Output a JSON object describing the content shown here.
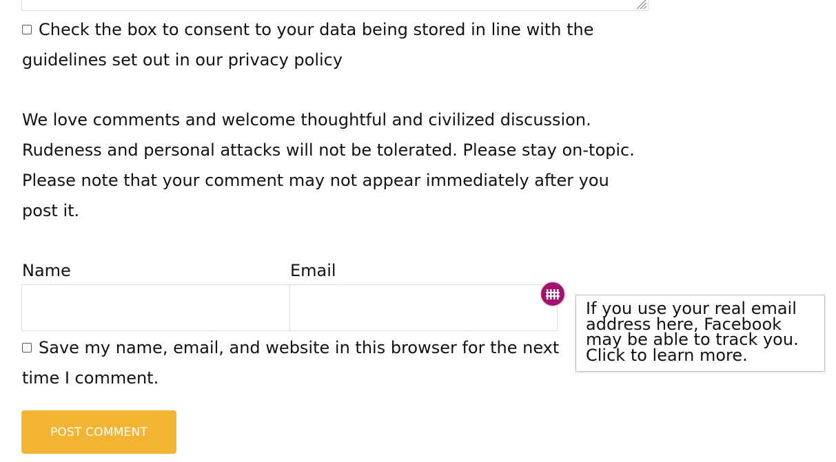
{
  "consent": {
    "text": "Check the box to consent to your data being stored in line with the guidelines set out in our privacy policy"
  },
  "rules": {
    "text": "We love comments and welcome thoughtful and civilized discussion. Rudeness and personal attacks will not be tolerated. Please stay on-topic. Please note that your comment may not appear immediately after you post it."
  },
  "form": {
    "name_label": "Name",
    "email_label": "Email",
    "name_value": "",
    "email_value": "",
    "save_info_text": "Save my name, email, and website in this browser for the next time I comment."
  },
  "submit": {
    "label": "POST COMMENT"
  },
  "facebook_container": {
    "icon": "fence-icon",
    "tooltip": "If you use your real email address here, Facebook may be able to track you. Click to learn more."
  },
  "colors": {
    "button": "#f3b433",
    "badge": "#a3126f"
  }
}
